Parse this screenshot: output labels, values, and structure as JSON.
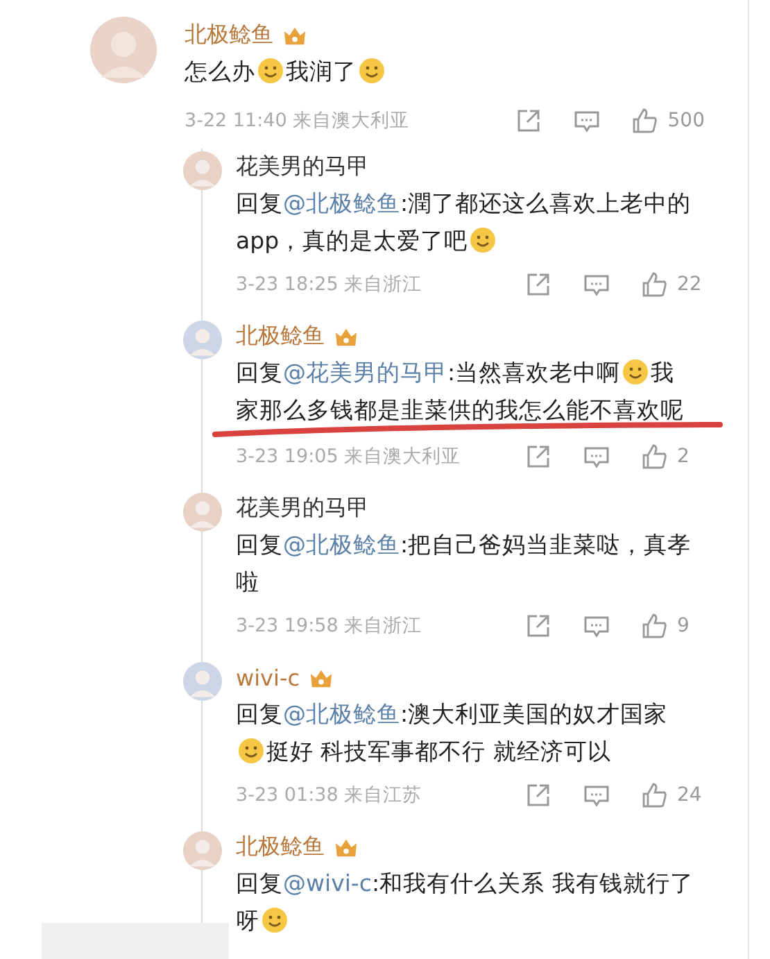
{
  "comment": {
    "name": "北极鲶鱼",
    "vip": true,
    "content": [
      {
        "kind": "text",
        "text": "怎么办"
      },
      {
        "kind": "emoji"
      },
      {
        "kind": "text",
        "text": "我润了"
      },
      {
        "kind": "emoji"
      }
    ],
    "time": "3-22 11:40",
    "location": "来自澳大利亚",
    "likes": "500"
  },
  "replies": [
    {
      "name": "花美男的马甲",
      "vip": false,
      "underlined": false,
      "prefix": "回复",
      "mention": "@北极鲶鱼",
      "content": [
        {
          "kind": "text",
          "text": ":潤了都还这么喜欢上老中的app，真的是太爱了吧"
        },
        {
          "kind": "emoji"
        }
      ],
      "time": "3-23 18:25",
      "location": "来自浙江",
      "likes": "22"
    },
    {
      "name": "北极鲶鱼",
      "vip": true,
      "underlined": true,
      "prefix": "回复",
      "mention": "@花美男的马甲",
      "content": [
        {
          "kind": "text",
          "text": ":当然喜欢老中啊"
        },
        {
          "kind": "emoji"
        },
        {
          "kind": "text",
          "text": "我家那么多钱都是韭菜供的我怎么能不喜欢呢"
        }
      ],
      "time": "3-23 19:05",
      "location": "来自澳大利亚",
      "likes": "2"
    },
    {
      "name": "花美男的马甲",
      "vip": false,
      "underlined": false,
      "prefix": "回复",
      "mention": "@北极鲶鱼",
      "content": [
        {
          "kind": "text",
          "text": ":把自己爸妈当韭菜哒，真孝啦"
        }
      ],
      "time": "3-23 19:58",
      "location": "来自浙江",
      "likes": "9"
    },
    {
      "name": "wivi-c",
      "vip": true,
      "underlined": false,
      "prefix": "回复",
      "mention": "@北极鲶鱼",
      "content": [
        {
          "kind": "text",
          "text": ":澳大利亚美国的奴才国家"
        },
        {
          "kind": "emoji"
        },
        {
          "kind": "text",
          "text": "挺好 科技军事都不行 就经济可以"
        }
      ],
      "time": "3-23 01:38",
      "location": "来自江苏",
      "likes": "24"
    },
    {
      "name": "北极鲶鱼",
      "vip": true,
      "underlined": false,
      "prefix": "回复",
      "mention": "@wivi-c",
      "content": [
        {
          "kind": "text",
          "text": ":和我有什么关系 我有钱就行了呀"
        },
        {
          "kind": "emoji"
        }
      ]
    }
  ]
}
